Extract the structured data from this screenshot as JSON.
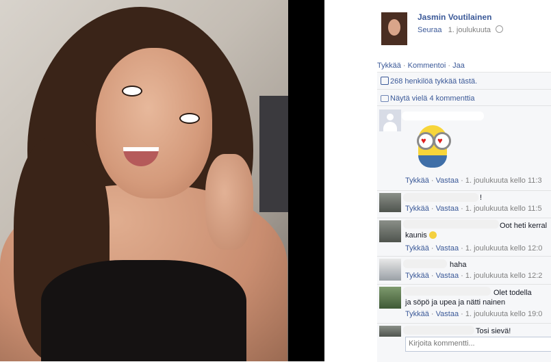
{
  "post": {
    "author": "Jasmin Voutilainen",
    "follow_label": "Seuraa",
    "date": "1. joulukuuta"
  },
  "actions": {
    "like": "Tykkää",
    "comment": "Kommentoi",
    "share": "Jaa",
    "separator": "·"
  },
  "feedback": {
    "likes_text": "268 henkilöä tykkää tästä.",
    "more_comments": "Näytä vielä 4 kommenttia"
  },
  "comments": [
    {
      "name": "",
      "text": "",
      "like": "Tykkää",
      "reply": "Vastaa",
      "time": "1. joulukuuta kello 11:3"
    },
    {
      "name": "",
      "text": "!",
      "like": "Tykkää",
      "reply": "Vastaa",
      "time": "1. joulukuuta kello 11:5"
    },
    {
      "name": "",
      "text": "Oot heti kerral",
      "text2": "kaunis",
      "like": "Tykkää",
      "reply": "Vastaa",
      "time": "1. joulukuuta kello 12:0"
    },
    {
      "name": "",
      "text": "haha",
      "like": "Tykkää",
      "reply": "Vastaa",
      "time": "1. joulukuuta kello 12:2"
    },
    {
      "name": "",
      "text": "Olet todella",
      "text2": "ja söpö ja upea ja nätti nainen",
      "like": "Tykkää",
      "reply": "Vastaa",
      "time": "1. joulukuuta kello 19:0"
    },
    {
      "name": "",
      "text": "Tosi sievä!"
    }
  ],
  "reply_box": {
    "placeholder": "Kirjoita kommentti..."
  }
}
